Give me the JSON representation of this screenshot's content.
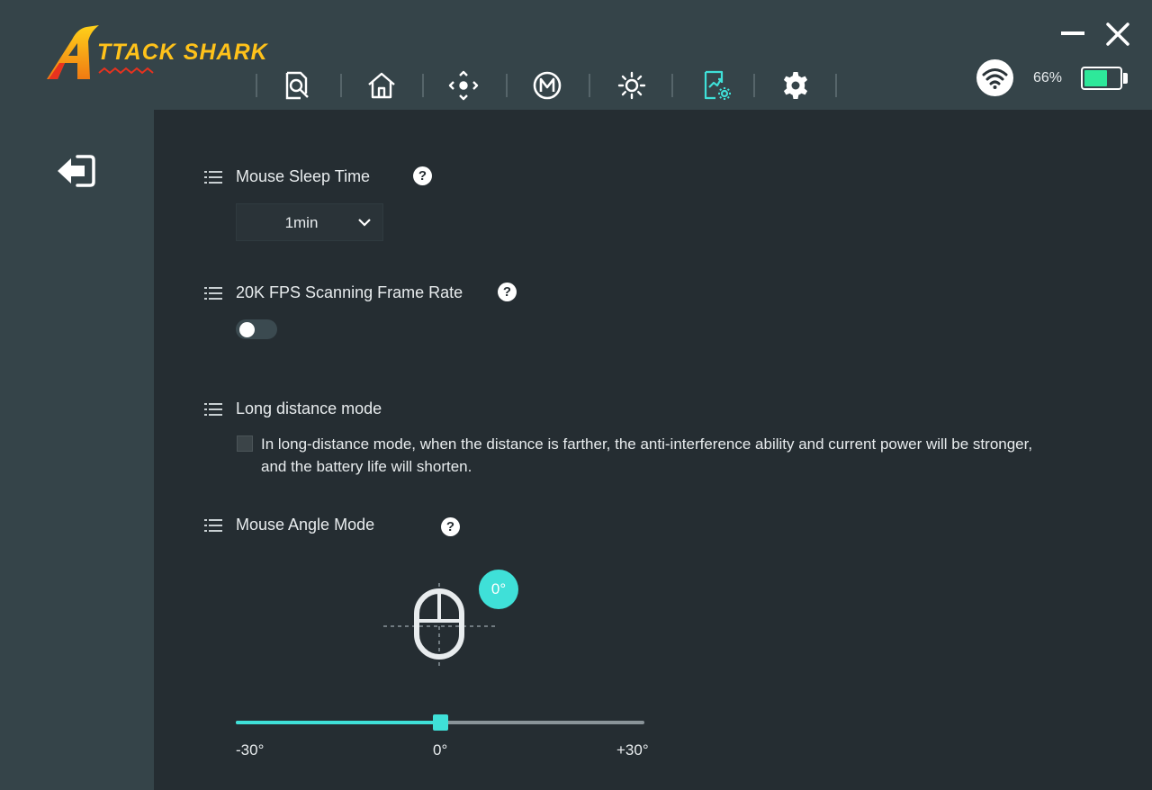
{
  "app": {
    "brand": "ATTACK SHARK",
    "colors": {
      "accent": "#3fe0d8",
      "battery": "#2ee89a",
      "header": "#354449",
      "content": "#252d32",
      "logo_yellow": "#ffc21a",
      "logo_red": "#e8321e"
    }
  },
  "nav": {
    "items": [
      {
        "icon": "search-report-icon",
        "active": false
      },
      {
        "icon": "home-icon",
        "active": false
      },
      {
        "icon": "dpad-icon",
        "active": false
      },
      {
        "icon": "macro-m-icon",
        "active": false
      },
      {
        "icon": "brightness-icon",
        "active": false
      },
      {
        "icon": "performance-settings-icon",
        "active": true
      },
      {
        "icon": "gear-icon",
        "active": false
      }
    ]
  },
  "status": {
    "connection_icon": "wifi-icon",
    "battery_percent": "66%",
    "battery_level": 0.66
  },
  "window": {
    "minimize_icon": "minimize-icon",
    "close_icon": "close-icon"
  },
  "sidebar": {
    "back_icon": "exit-icon"
  },
  "settings": {
    "sleep": {
      "title": "Mouse Sleep Time",
      "help": "?",
      "value": "1min"
    },
    "fps": {
      "title": "20K FPS Scanning Frame Rate",
      "help": "?",
      "enabled": false
    },
    "long_distance": {
      "title": "Long distance mode",
      "checked": false,
      "description": "In long-distance mode, when the distance is farther, the anti-interference ability and current power will be stronger, and the battery life will shorten."
    },
    "angle": {
      "title": "Mouse Angle Mode",
      "help": "?",
      "current_label": "0°",
      "value": 0,
      "min": -30,
      "max": 30,
      "min_label": "-30°",
      "mid_label": "0°",
      "max_label": "+30°"
    }
  }
}
